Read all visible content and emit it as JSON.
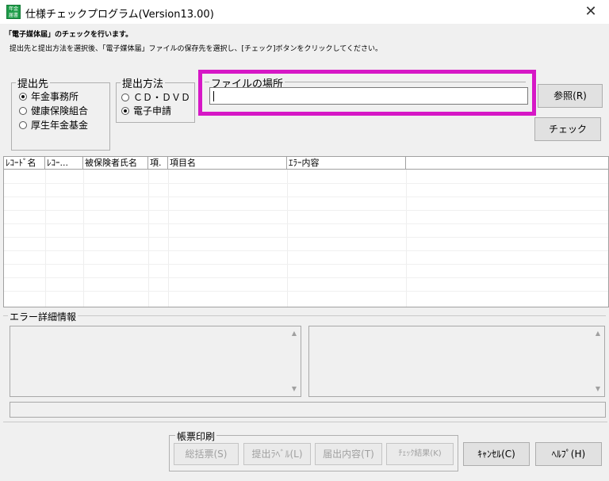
{
  "window": {
    "icon_text": "年金 届書",
    "title": "仕様チェックプログラム(Version13.00)",
    "close_glyph": "✕"
  },
  "intro": {
    "line1": "「電子媒体届」のチェックを行います。",
    "line2": "提出先と提出方法を選択後、「電子媒体届」ファイルの保存先を選択し、[チェック]ボタンをクリックしてください。"
  },
  "submit_to": {
    "legend": "提出先",
    "options": [
      {
        "label": "年金事務所",
        "selected": true
      },
      {
        "label": "健康保険組合",
        "selected": false
      },
      {
        "label": "厚生年金基金",
        "selected": false
      }
    ]
  },
  "method": {
    "legend": "提出方法",
    "options": [
      {
        "label": "ＣＤ・ＤＶＤ",
        "selected": false
      },
      {
        "label": "電子申請",
        "selected": true
      }
    ]
  },
  "file_location": {
    "legend": "ファイルの場所",
    "value": "",
    "highlight_color": "#d617c6"
  },
  "buttons": {
    "browse": "参照(R)",
    "check": "チェック",
    "cancel": "ｷｬﾝｾﾙ(C)",
    "help": "ﾍﾙﾌﾟ(H)"
  },
  "grid": {
    "columns": [
      "ﾚｺｰﾄﾞ名",
      "ﾚｺｰ...",
      "被保険者氏名",
      "項.",
      "項目名",
      "ｴﾗｰ内容",
      ""
    ],
    "rows": []
  },
  "error_detail": {
    "legend": "エラー詳細情報",
    "scroll_up": "▲",
    "scroll_down": "▼"
  },
  "print": {
    "legend": "帳票印刷",
    "buttons": [
      "総括票(S)",
      "提出ﾗﾍﾞﾙ(L)",
      "届出内容(T)",
      "ﾁｪｯｸ結果(K)"
    ],
    "enabled": false
  }
}
